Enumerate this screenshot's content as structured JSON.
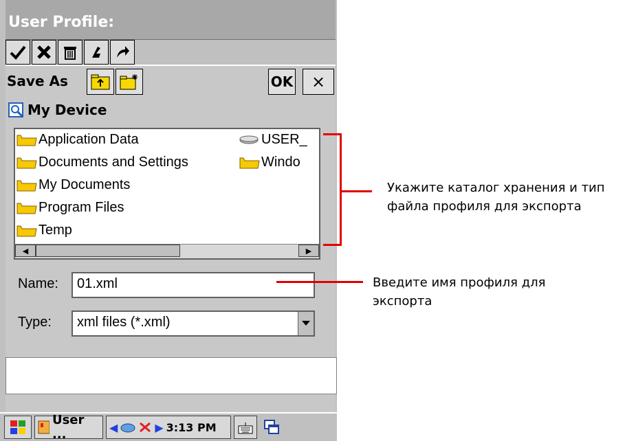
{
  "window": {
    "title": "User Profile:"
  },
  "toolbar": {
    "buttons": [
      "check-icon",
      "close-icon",
      "delete-icon",
      "import-icon",
      "export-icon"
    ]
  },
  "dialog": {
    "title": "Save As",
    "ok_label": "OK",
    "close_label": "×",
    "location": "My Device"
  },
  "files": {
    "left": [
      "Application Data",
      "Documents and Settings",
      "My Documents",
      "Program Files",
      "Temp"
    ],
    "right": [
      "USER_",
      "Windo"
    ]
  },
  "form": {
    "name_label": "Name:",
    "name_value": "01.xml",
    "type_label": "Type:",
    "type_value": "xml files (*.xml)"
  },
  "taskbar": {
    "app_label": "User ...",
    "time": "3:13 PM"
  },
  "annotations": {
    "folder_note": "Укажите каталог хранения и тип файла профиля для экспорта",
    "name_note": "Введите имя профиля для экспорта"
  },
  "colors": {
    "accent": "#e00000",
    "folder": "#f8c800"
  }
}
